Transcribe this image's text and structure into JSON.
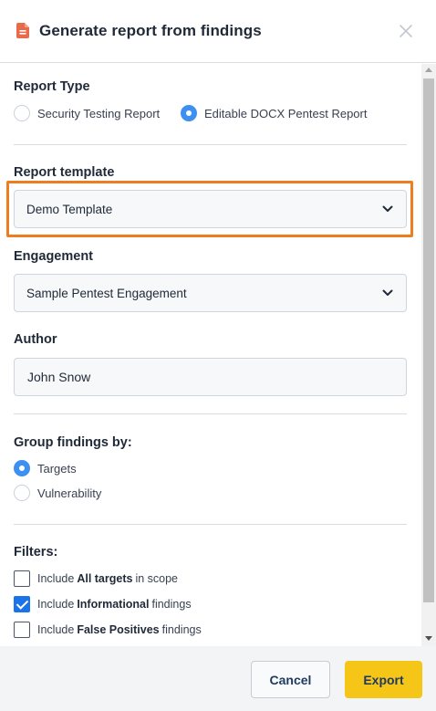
{
  "header": {
    "title": "Generate report from findings",
    "icon": "document-icon",
    "accent_color": "#e86a4a"
  },
  "report_type": {
    "label": "Report Type",
    "options": [
      {
        "label": "Security Testing Report",
        "checked": false
      },
      {
        "label": "Editable DOCX Pentest Report",
        "checked": true
      }
    ]
  },
  "report_template": {
    "label": "Report template",
    "value": "Demo Template",
    "highlight_color": "#ee7d1f"
  },
  "engagement": {
    "label": "Engagement",
    "value": "Sample Pentest Engagement"
  },
  "author": {
    "label": "Author",
    "value": "John Snow"
  },
  "group_by": {
    "label": "Group findings by:",
    "options": [
      {
        "label": "Targets",
        "checked": true
      },
      {
        "label": "Vulnerability",
        "checked": false
      }
    ]
  },
  "filters": {
    "label": "Filters:",
    "items": [
      {
        "prefix": "Include",
        "bold": "All targets",
        "suffix": "in scope",
        "checked": false
      },
      {
        "prefix": "Include",
        "bold": "Informational",
        "suffix": "findings",
        "checked": true
      },
      {
        "prefix": "Include",
        "bold": "False Positives",
        "suffix": "findings",
        "checked": false
      }
    ]
  },
  "footer": {
    "cancel_label": "Cancel",
    "export_label": "Export",
    "export_color": "#f5c518"
  }
}
